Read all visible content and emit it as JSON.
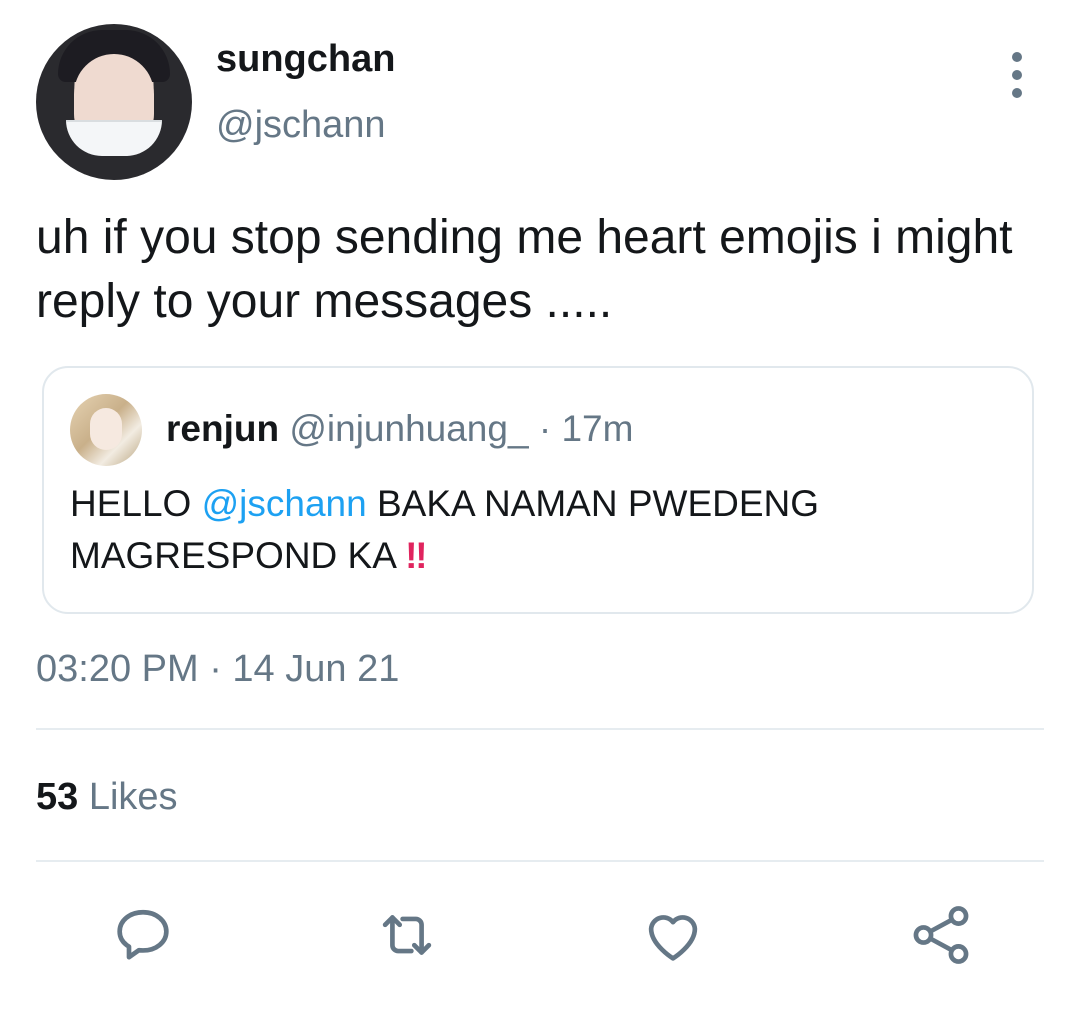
{
  "tweet": {
    "display_name": "sungchan",
    "handle": "@jschann",
    "text": "uh if you stop sending me heart emojis i might reply to your messages .....",
    "timestamp": "03:20 PM · 14 Jun 21",
    "likes_count": "53",
    "likes_label": "Likes"
  },
  "quote": {
    "display_name": "renjun",
    "handle": "@injunhuang_",
    "dot": "·",
    "time": "17m",
    "text_prefix": "HELLO ",
    "mention": "@jschann",
    "text_suffix": " BAKA NAMAN PWEDENG MAGRESPOND KA ",
    "emoji": "‼"
  },
  "actions": {
    "icons": [
      "reply-icon",
      "retweet-icon",
      "like-icon",
      "share-icon"
    ]
  },
  "colors": {
    "text": "#14171a",
    "secondary": "#657786",
    "accent": "#1da1f2",
    "divider": "#e6ecf0",
    "emoji_red": "#e0245e"
  }
}
